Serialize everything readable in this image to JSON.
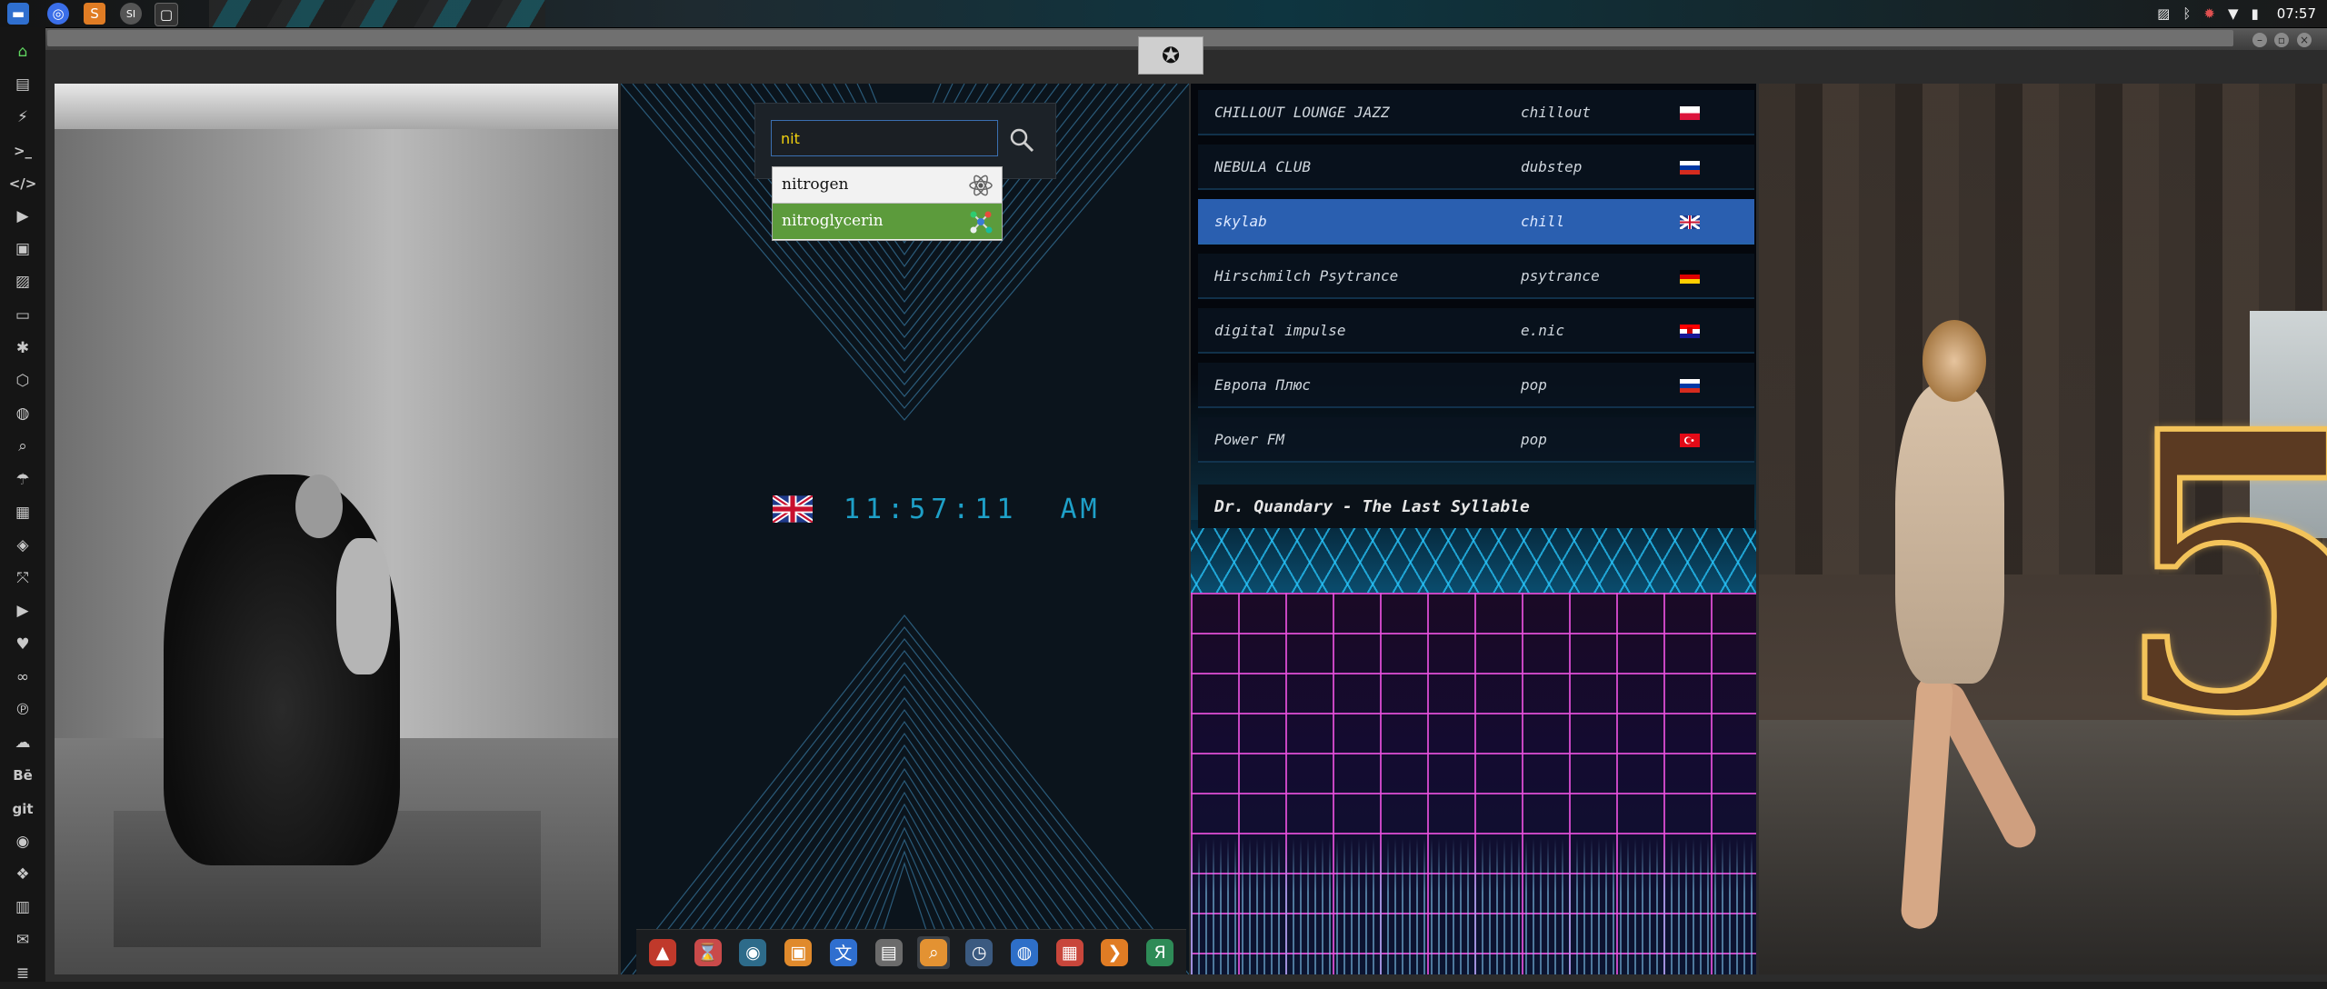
{
  "system_bar": {
    "clock": "07:57",
    "tray_icons": [
      "image-icon",
      "bluetooth-icon",
      "bug-icon",
      "wifi-icon",
      "battery-icon"
    ]
  },
  "sidebar": {
    "items": [
      {
        "name": "home-icon",
        "glyph": "⌂"
      },
      {
        "name": "document-icon",
        "glyph": "▤"
      },
      {
        "name": "bolt-icon",
        "glyph": "⚡"
      },
      {
        "name": "terminal-icon",
        "glyph": ">_"
      },
      {
        "name": "code-icon",
        "glyph": "</>"
      },
      {
        "name": "play-icon",
        "glyph": "▶"
      },
      {
        "name": "files-icon",
        "glyph": "▣"
      },
      {
        "name": "image-icon",
        "glyph": "▨"
      },
      {
        "name": "id-card-icon",
        "glyph": "▭"
      },
      {
        "name": "snowflake-icon",
        "glyph": "✱"
      },
      {
        "name": "hexagon-icon",
        "glyph": "⬡"
      },
      {
        "name": "globe-icon",
        "glyph": "◍"
      },
      {
        "name": "search-icon",
        "glyph": "⌕"
      },
      {
        "name": "umbrella-icon",
        "glyph": "☂"
      },
      {
        "name": "contact-icon",
        "glyph": "▦"
      },
      {
        "name": "tag-icon",
        "glyph": "◈"
      },
      {
        "name": "expand-icon",
        "glyph": "⤧"
      },
      {
        "name": "youtube-icon",
        "glyph": "▶"
      },
      {
        "name": "heart-icon",
        "glyph": "♥"
      },
      {
        "name": "infinity-icon",
        "glyph": "∞"
      },
      {
        "name": "pinterest-icon",
        "glyph": "℗"
      },
      {
        "name": "cloud-icon",
        "glyph": "☁"
      },
      {
        "name": "behance-icon",
        "glyph": "Bē"
      },
      {
        "name": "git-icon",
        "glyph": "git"
      },
      {
        "name": "github-icon",
        "glyph": "◉"
      },
      {
        "name": "puzzle-icon",
        "glyph": "❖"
      },
      {
        "name": "map-icon",
        "glyph": "▥"
      },
      {
        "name": "mail-icon",
        "glyph": "✉"
      },
      {
        "name": "storage-icon",
        "glyph": "≣"
      }
    ]
  },
  "window": {
    "logo_icon": "rebel-alliance-icon"
  },
  "search": {
    "query": "nit",
    "suggestions": [
      {
        "label": "nitrogen",
        "icon": "atom-icon"
      },
      {
        "label": "nitroglycerin",
        "icon": "molecule-icon"
      }
    ]
  },
  "clock_widget": {
    "flag": "united-kingdom-flag",
    "time": "11:57:11",
    "ampm": "AM"
  },
  "dock": {
    "apps": [
      {
        "name": "arch-icon",
        "glyph": "▲",
        "color": "#c0392b"
      },
      {
        "name": "hourglass-icon",
        "glyph": "⌛",
        "color": "#c94a4a"
      },
      {
        "name": "planet-icon",
        "glyph": "◉",
        "color": "#2d6b8a"
      },
      {
        "name": "image-viewer-icon",
        "glyph": "▣",
        "color": "#e08a2c"
      },
      {
        "name": "translate-icon",
        "glyph": "文",
        "color": "#2f6fcf"
      },
      {
        "name": "screen-icon",
        "glyph": "▤",
        "color": "#6b6b6b"
      },
      {
        "name": "search-app-icon",
        "glyph": "⌕",
        "color": "#e39232"
      },
      {
        "name": "clock-app-icon",
        "glyph": "◷",
        "color": "#3b5a80"
      },
      {
        "name": "browser-icon",
        "glyph": "◍",
        "color": "#2e6fc8"
      },
      {
        "name": "calendar-icon",
        "glyph": "▦",
        "color": "#c8463b"
      },
      {
        "name": "sublime-icon",
        "glyph": "❯",
        "color": "#e07c24"
      },
      {
        "name": "yandex-icon",
        "glyph": "Я",
        "color": "#2e8b57"
      }
    ]
  },
  "radio": {
    "stations": [
      {
        "name": "CHILLOUT LOUNGE JAZZ",
        "genre": "chillout",
        "flag": "poland"
      },
      {
        "name": "NEBULA CLUB",
        "genre": "dubstep",
        "flag": "russia"
      },
      {
        "name": "skylab",
        "genre": "chill",
        "flag": "united-kingdom",
        "selected": true
      },
      {
        "name": "Hirschmilch Psytrance",
        "genre": "psytrance",
        "flag": "germany"
      },
      {
        "name": "digital impulse",
        "genre": "e.nic",
        "flag": "croatia"
      },
      {
        "name": "Европа Плюс",
        "genre": "pop",
        "flag": "russia"
      },
      {
        "name": "Power FM",
        "genre": "pop",
        "flag": "turkey"
      }
    ],
    "now_playing": "Dr. Quandary - The Last Syllable"
  },
  "colors": {
    "accent_green": "#5fd35f",
    "selected_row": "#2a5fb0",
    "clock_cyan": "#1ea0c8",
    "query_text": "#f2d20f"
  }
}
